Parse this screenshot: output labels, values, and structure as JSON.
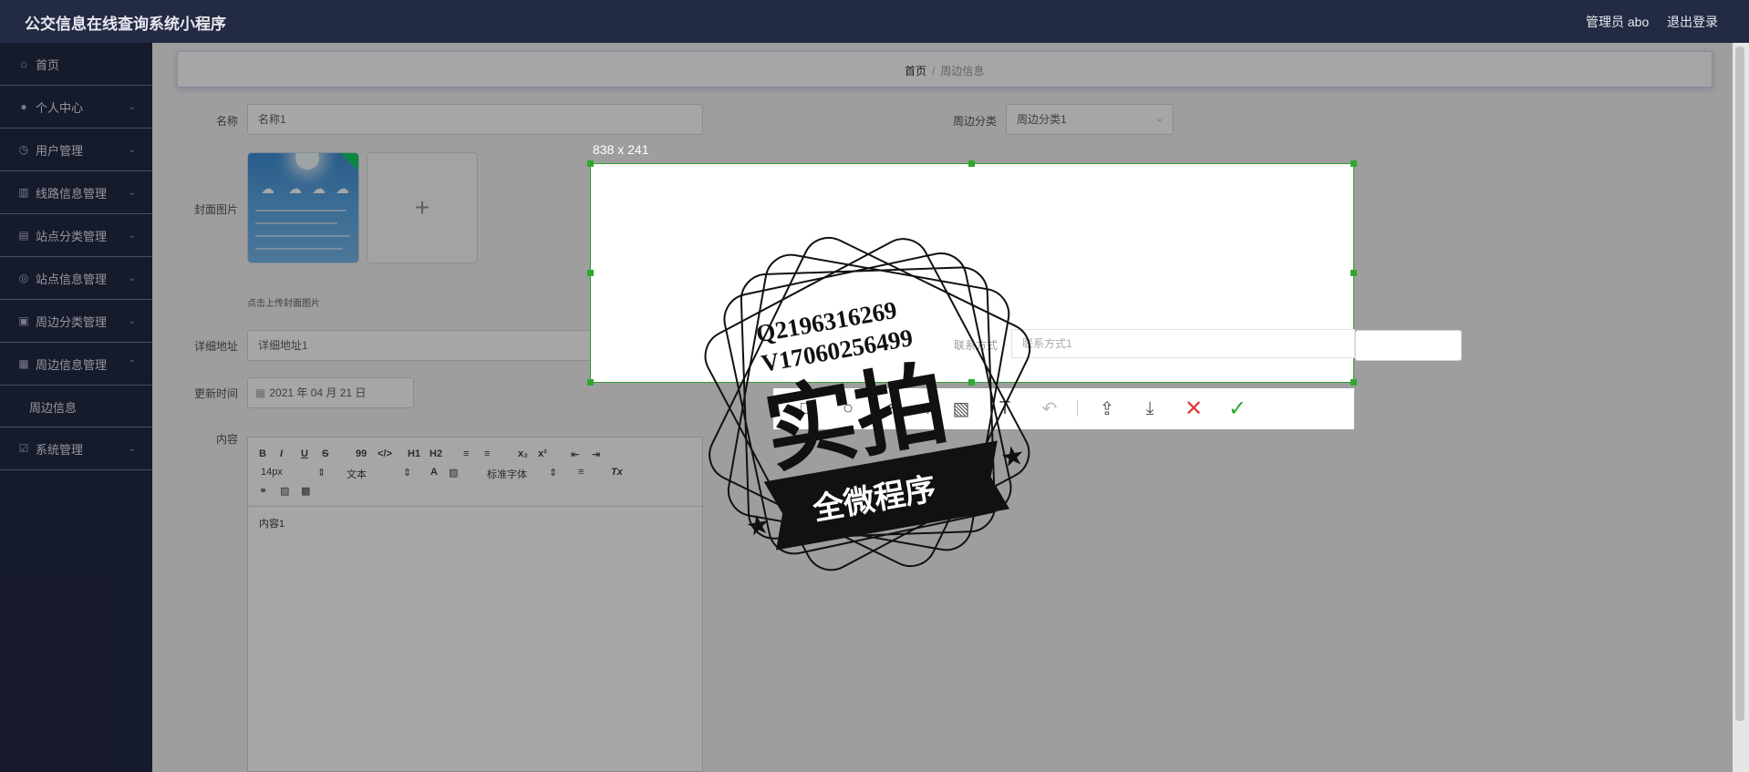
{
  "header": {
    "app_title": "公交信息在线查询系统小程序",
    "user": "管理员 abo",
    "logout": "退出登录"
  },
  "sidebar": {
    "items": [
      {
        "label": "首页",
        "icon": "home-icon"
      },
      {
        "label": "个人中心",
        "icon": "user-icon"
      },
      {
        "label": "用户管理",
        "icon": "clock-icon"
      },
      {
        "label": "线路信息管理",
        "icon": "chart-icon"
      },
      {
        "label": "站点分类管理",
        "icon": "clipboard-icon"
      },
      {
        "label": "站点信息管理",
        "icon": "compass-icon"
      },
      {
        "label": "周边分类管理",
        "icon": "briefcase-icon"
      },
      {
        "label": "周边信息管理",
        "icon": "grid-icon"
      },
      {
        "label": "系统管理",
        "icon": "checkbox-icon"
      }
    ],
    "sub_item": "周边信息"
  },
  "breadcrumb": {
    "home": "首页",
    "current": "周边信息"
  },
  "form": {
    "name_label": "名称",
    "name_value": "名称1",
    "category_label": "周边分类",
    "category_value": "周边分类1",
    "cover_label": "封面图片",
    "upload_hint": "点击上传封面图片",
    "address_label": "详细地址",
    "address_value": "详细地址1",
    "contact_label": "联系方式",
    "contact_value": "联系方式1",
    "update_label": "更新时间",
    "update_value": "2021 年 04 月 21 日",
    "content_label": "内容",
    "content_value": "内容1"
  },
  "editor_toolbar": {
    "row1": [
      "B",
      "I",
      "U",
      "S",
      "99",
      "</>",
      "H1",
      "H2",
      "≡",
      "≡",
      "x₂",
      "x²",
      "⇤",
      "⇥"
    ],
    "font_size": "14px",
    "block_type": "文本",
    "font_family": "标准字体"
  },
  "capture": {
    "size_label": "838 x 241",
    "tools": [
      "rectangle-tool-icon",
      "ellipse-tool-icon",
      "arrow-tool-icon",
      "pen-tool-icon",
      "mosaic-tool-icon",
      "text-tool-icon",
      "undo-icon",
      "share-icon",
      "download-icon",
      "cancel-icon",
      "confirm-icon"
    ]
  },
  "watermark": {
    "line1": "Q2196316269",
    "line2": "V17060256499",
    "big": "实拍",
    "banner": "全微程序"
  },
  "colors": {
    "nav_bg": "#232a44",
    "accent_green": "#2fa82f",
    "cancel_red": "#e03a3a"
  }
}
